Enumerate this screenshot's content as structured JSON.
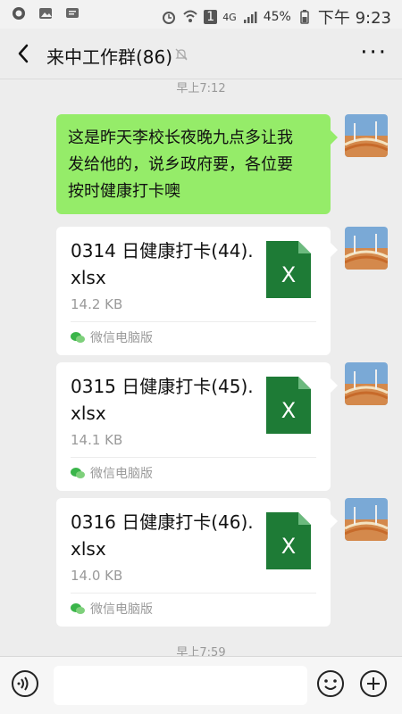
{
  "status_bar": {
    "network": "4G",
    "signal_bars": "1",
    "battery_percent": "45%",
    "time": "下午 9:23"
  },
  "header": {
    "title": "来中工作群(86)"
  },
  "messages": {
    "timestamp_top": "早上7:12",
    "text_message": "这是昨天李校长夜晚九点多让我\n发给他的，说乡政府要，各位要\n按时健康打卡噢",
    "files": [
      {
        "name": "0314  日健康打卡(44).\nxlsx",
        "size": "14.2 KB",
        "source": "微信电脑版",
        "icon_letter": "X"
      },
      {
        "name": "0315 日健康打卡(45).\nxlsx",
        "size": "14.1 KB",
        "source": "微信电脑版",
        "icon_letter": "X"
      },
      {
        "name": "0316 日健康打卡(46).\nxlsx",
        "size": "14.0 KB",
        "source": "微信电脑版",
        "icon_letter": "X"
      }
    ],
    "timestamp_bottom": "早上7:59"
  },
  "colors": {
    "green_bubble": "#95ec69",
    "excel_green": "#1e7b36"
  }
}
